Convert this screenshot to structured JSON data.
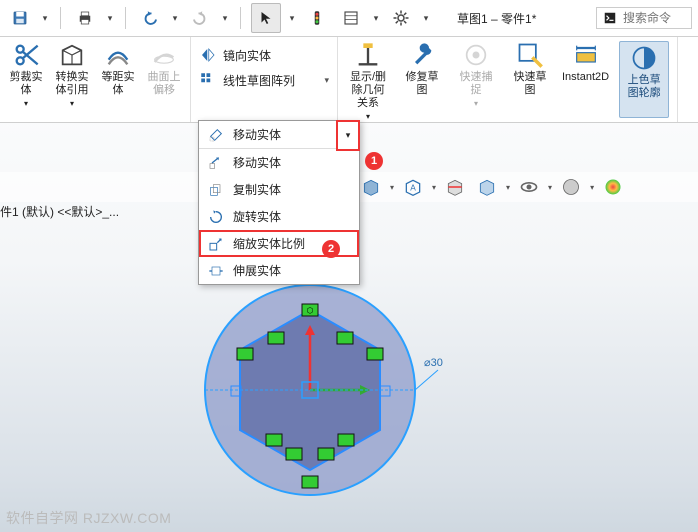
{
  "doc_title": "草图1 – 零件1*",
  "search_placeholder": "搜索命令",
  "ribbon": {
    "trim_label": "剪裁实\n体",
    "convert_label": "转换实\n体引用",
    "offset_label": "等距实\n体",
    "surface_offset_label": "曲面上\n偏移",
    "mirror_label": "镜向实体",
    "pattern_label": "线性草图阵列",
    "move_label": "移动实体",
    "display_label": "显示/删\n除几何\n关系",
    "repair_label": "修复草\n图",
    "quicksnap_label": "快速捕\n捉",
    "rapidsketch_label": "快速草\n图",
    "instant2d_label": "Instant2D",
    "profile_label": "上色草\n图轮廓"
  },
  "dropdown": {
    "head": "移动实体",
    "items": [
      "移动实体",
      "复制实体",
      "旋转实体",
      "缩放实体比例",
      "伸展实体"
    ]
  },
  "tree_text": "件1 (默认) <<默认>_...",
  "dim_label": "⌀30",
  "footer": "软件自学网  RJZXW.COM"
}
